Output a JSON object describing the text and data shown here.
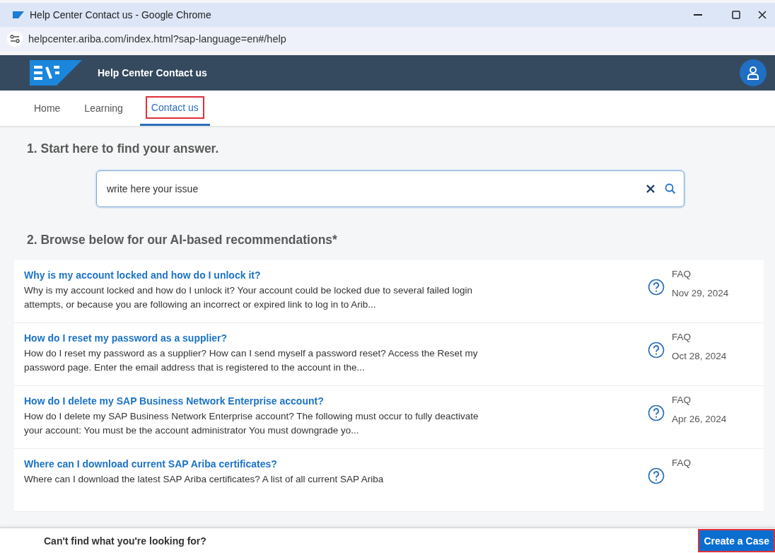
{
  "window": {
    "title": "Help Center Contact us - Google Chrome"
  },
  "address_bar": {
    "url": "helpcenter.ariba.com/index.html?sap-language=en#/help"
  },
  "header": {
    "title": "Help Center Contact us"
  },
  "tabs": [
    {
      "label": "Home",
      "selected": false,
      "annotated": false
    },
    {
      "label": "Learning",
      "selected": false,
      "annotated": false
    },
    {
      "label": "Contact us",
      "selected": true,
      "annotated": true
    }
  ],
  "step_1": {
    "heading": "1. Start here to find your answer.",
    "search": {
      "value": "write here your issue"
    }
  },
  "step_2": {
    "heading": "2. Browse below for our AI-based recommendations*"
  },
  "results": [
    {
      "title": "Why is my account locked and how do I unlock it?",
      "summary": "Why is my account locked and how do I unlock it? Your account could be locked due to several failed login attempts, or because you are following an incorrect or expired link to log in to Arib...",
      "type": "FAQ",
      "date": "Nov 29, 2024"
    },
    {
      "title": "How do I reset my password as a supplier?",
      "summary": "How do I reset my password as a supplier? How can I send myself a password reset? Access the Reset my password page. Enter the email address that is registered to the account in the...",
      "type": "FAQ",
      "date": "Oct 28, 2024"
    },
    {
      "title": "How do I delete my SAP Business Network Enterprise account?",
      "summary": "How do I delete my SAP Business Network Enterprise account? The following must occur to fully deactivate your account: You must be the account administrator You must downgrade yo...",
      "type": "FAQ",
      "date": "Apr 26, 2024"
    },
    {
      "title": "Where can I download current SAP Ariba certificates?",
      "summary": "Where can I download the latest SAP Ariba certificates? A list of all current SAP Ariba",
      "type": "FAQ"
    }
  ],
  "footer": {
    "text": "Can't find what you're looking for?",
    "button": {
      "label": "Create a Case",
      "annotated": true
    }
  }
}
